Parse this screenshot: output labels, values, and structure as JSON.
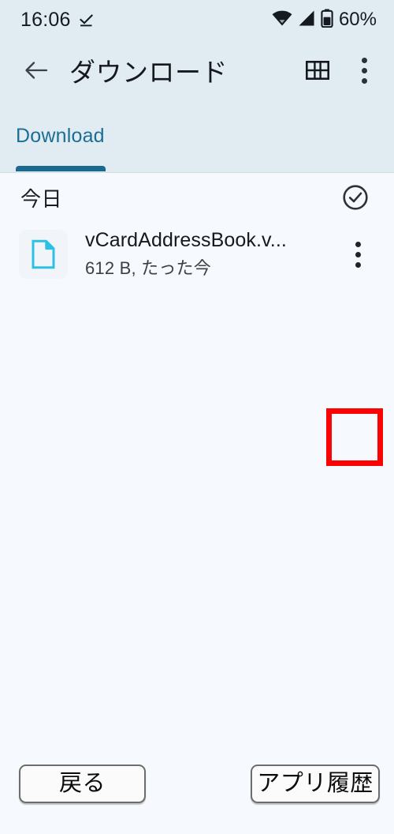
{
  "status_bar": {
    "time": "16:06",
    "dnd_icon": "check-underline-icon",
    "wifi_icon": "wifi-icon",
    "signal_icon": "cellular-signal-icon",
    "battery_icon": "battery-icon",
    "battery_percent": "60%"
  },
  "app_bar": {
    "back_icon": "arrow-left-icon",
    "title": "ダウンロード",
    "grid_view_icon": "grid-view-icon",
    "overflow_icon": "more-vertical-icon"
  },
  "tabs": [
    {
      "label": "Download",
      "selected": true
    }
  ],
  "colors": {
    "header_bg": "#E0EBF2",
    "content_bg": "#F6F9FD",
    "tab_active": "#1C6E94",
    "tab_indicator": "#1A6A8E",
    "file_icon": "#2BC0E4",
    "annotation": "#FB0303",
    "text_primary": "#16191D",
    "text_secondary": "#3B4148"
  },
  "list": {
    "group_title": "今日",
    "select_all_icon": "check-circle-icon",
    "items": [
      {
        "icon": "document-file-icon",
        "name": "vCardAddressBook.v...",
        "size": "612 B",
        "time": "たった今",
        "subtitle": "612 B, たった今",
        "overflow_icon": "more-vertical-icon",
        "highlighted": true
      }
    ]
  },
  "annotation": {
    "target": "file-overflow-menu",
    "color": "#FB0303"
  },
  "bottom_nav": {
    "back_label": "戻る",
    "recents_label": "アプリ履歴"
  }
}
